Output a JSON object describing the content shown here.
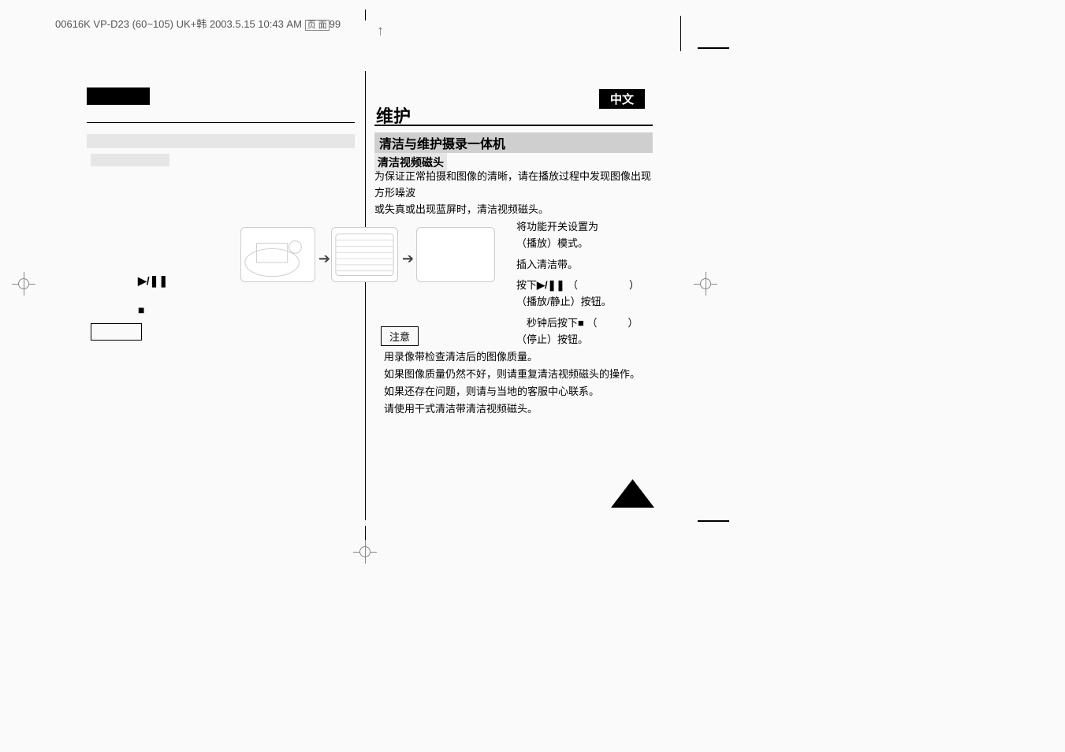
{
  "header": {
    "filename": "00616K VP-D23 (60~105) UK+韩 2003.5.15 10:43 AM",
    "page_label_prefix": "页 面",
    "page_number": "99"
  },
  "lang_tag": "中文",
  "title": "维护",
  "section_title": "清洁与维护摄录一体机",
  "subsection_title": "清洁视频磁头",
  "intro_line1": "为保证正常拍摄和图像的清晰，请在播放过程中发现图像出现方形噪波",
  "intro_line2": "或失真或出现蓝屏时，清洁视频磁头。",
  "steps": {
    "s1_line1": "将功能开关设置为",
    "s1_line2": "（播放）模式。",
    "s2": "插入清洁带。",
    "s3_pre": "按下",
    "s3_play_icon": "▶/❚❚",
    "s3_paren": "（　　　　　）",
    "s3_line2": "（播放/静止）按钮。",
    "s4_pre": "　秒钟后按下",
    "s4_stop_icon": "■",
    "s4_paren": "（　　　）",
    "s4_line2": "（停止）按钮。"
  },
  "notice_label": "注意",
  "bullets": {
    "b1": "用录像带检查清洁后的图像质量。",
    "b2": "如果图像质量仍然不好，则请重复清洁视频磁头的操作。",
    "b3": "如果还存在问题，则请与当地的客服中心联系。",
    "b4": "请使用干式清洁带清洁视频磁头。"
  },
  "left_icons": {
    "play_pause": "▶/❚❚",
    "stop": "■"
  }
}
